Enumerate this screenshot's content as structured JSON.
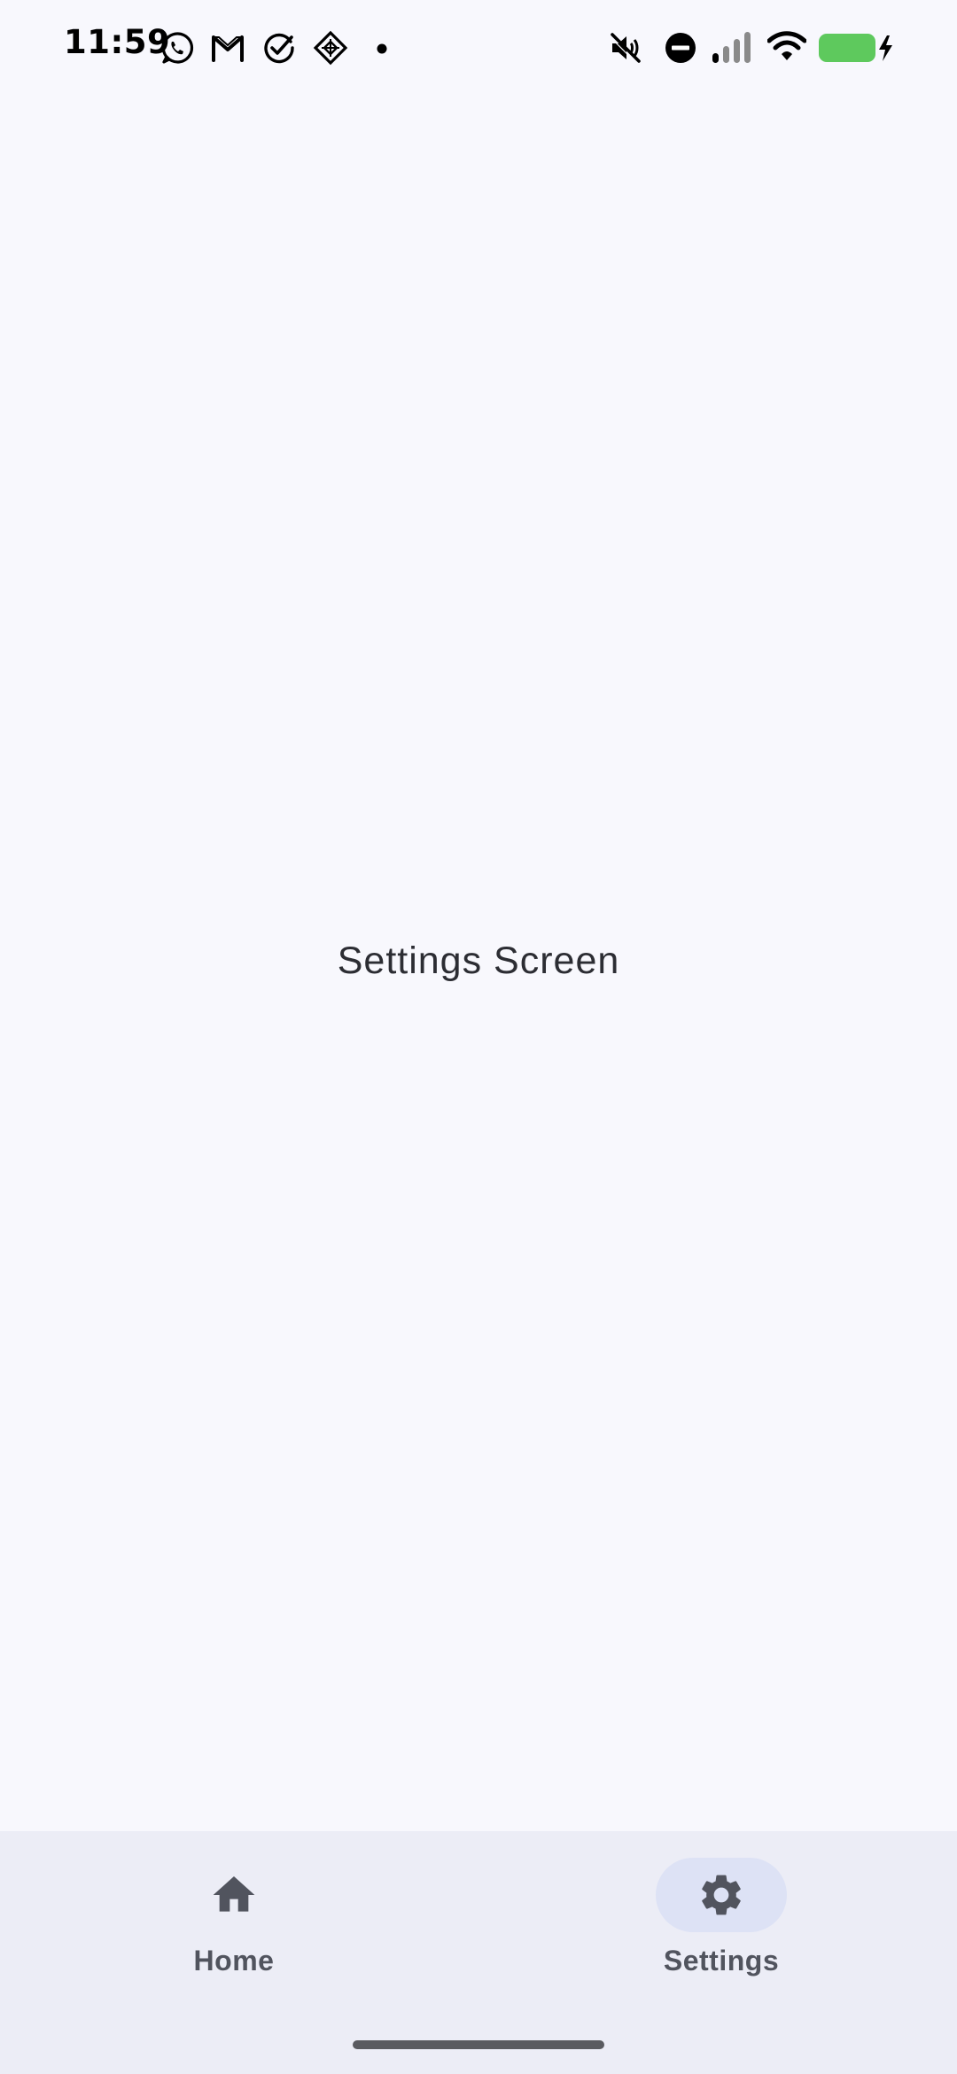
{
  "status_bar": {
    "time": "11:59",
    "left_icons": [
      "whatsapp-icon",
      "gmail-icon",
      "check-circle-icon",
      "app-diamond-icon",
      "more-notifications-dot-icon"
    ],
    "right_icons": [
      "mute-icon",
      "do-not-disturb-icon",
      "signal-icon",
      "wifi-icon",
      "battery-charging-icon"
    ],
    "battery_color": "#5ec95d"
  },
  "main": {
    "label": "Settings Screen"
  },
  "bottom_nav": {
    "items": [
      {
        "label": "Home",
        "icon": "home-icon",
        "selected": false
      },
      {
        "label": "Settings",
        "icon": "gear-icon",
        "selected": true
      }
    ],
    "background": "#ecedf6",
    "selected_indicator_color": "#dde2f5"
  }
}
